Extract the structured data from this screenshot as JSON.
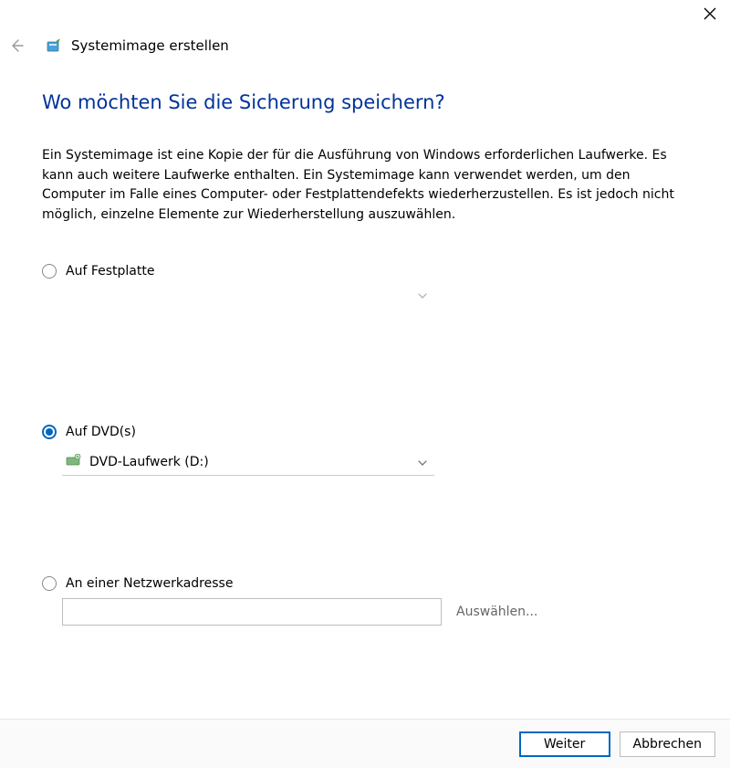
{
  "window": {
    "wizard_title": "Systemimage erstellen"
  },
  "page": {
    "heading": "Wo möchten Sie die Sicherung speichern?",
    "description": "Ein Systemimage ist eine Kopie der für die Ausführung von Windows erforderlichen Laufwerke. Es kann auch weitere Laufwerke enthalten. Ein Systemimage kann verwendet werden, um den Computer im Falle eines Computer- oder Festplattendefekts wiederherzustellen. Es ist jedoch nicht möglich, einzelne Elemente zur Wiederherstellung auszuwählen."
  },
  "options": {
    "hard_disk": {
      "label": "Auf Festplatte",
      "selected": false
    },
    "dvd": {
      "label": "Auf DVD(s)",
      "selected": true,
      "drive_label": "DVD-Laufwerk (D:)"
    },
    "network": {
      "label": "An einer Netzwerkadresse",
      "selected": false,
      "path_value": "",
      "browse_label": "Auswählen..."
    }
  },
  "buttons": {
    "next": "Weiter",
    "cancel": "Abbrechen"
  }
}
